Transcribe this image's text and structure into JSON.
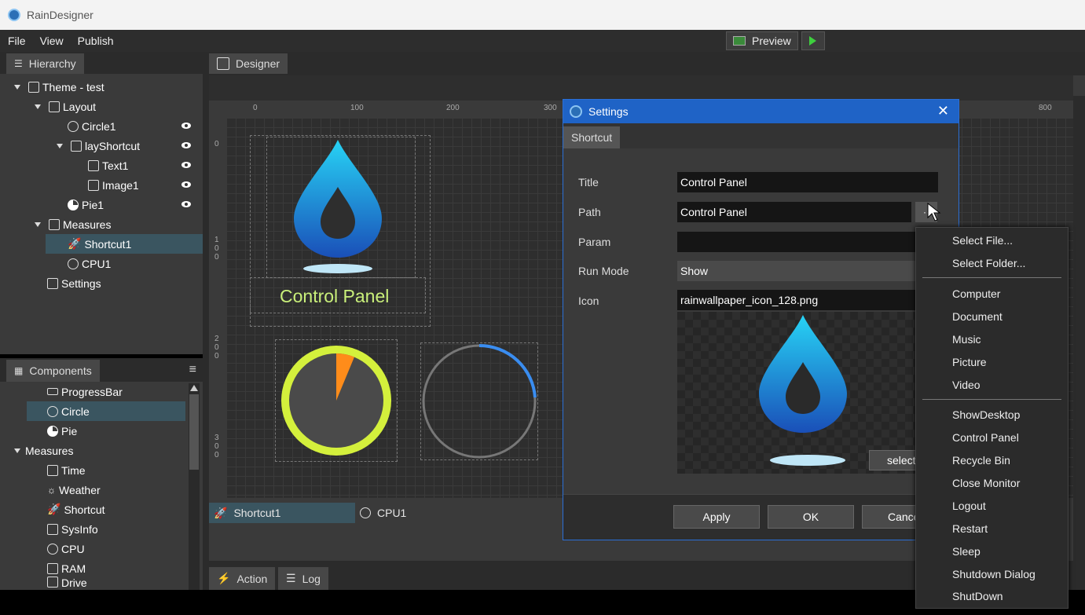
{
  "app": {
    "title": "RainDesigner"
  },
  "menu": [
    "File",
    "View",
    "Publish"
  ],
  "toolbar": {
    "preview_label": "Preview"
  },
  "hierarchy": {
    "tab_label": "Hierarchy",
    "items": [
      {
        "label": "Theme - test"
      },
      {
        "label": "Layout"
      },
      {
        "label": "Circle1"
      },
      {
        "label": "layShortcut"
      },
      {
        "label": "Text1"
      },
      {
        "label": "Image1"
      },
      {
        "label": "Pie1"
      },
      {
        "label": "Measures"
      },
      {
        "label": "Shortcut1"
      },
      {
        "label": "CPU1"
      },
      {
        "label": "Settings"
      }
    ]
  },
  "components": {
    "tab_label": "Components",
    "items": [
      {
        "label": "ProgressBar"
      },
      {
        "label": "Circle"
      },
      {
        "label": "Pie"
      },
      {
        "label": "Measures"
      },
      {
        "label": "Time"
      },
      {
        "label": "Weather"
      },
      {
        "label": "Shortcut"
      },
      {
        "label": "SysInfo"
      },
      {
        "label": "CPU"
      },
      {
        "label": "RAM"
      },
      {
        "label": "Drive"
      }
    ]
  },
  "designer": {
    "tab_label": "Designer",
    "ruler_h": [
      "0",
      "100",
      "200",
      "300",
      "800"
    ],
    "ruler_v": [
      "0",
      "1\n0\n0",
      "2\n0\n0",
      "3\n0\n0"
    ],
    "canvas_text": "Control Panel",
    "bottom_items": [
      "Shortcut1",
      "CPU1"
    ]
  },
  "bottom_tabs": [
    "Action",
    "Log"
  ],
  "dialog": {
    "title": "Settings",
    "tab": "Shortcut",
    "labels": {
      "title": "Title",
      "path": "Path",
      "param": "Param",
      "run_mode": "Run Mode",
      "icon": "Icon"
    },
    "values": {
      "title": "Control Panel",
      "path": "Control Panel",
      "param": "",
      "run_mode": "Show",
      "icon": "rainwallpaper_icon_128.png"
    },
    "browse_label": "··",
    "select_label": "select",
    "buttons": {
      "apply": "Apply",
      "ok": "OK",
      "cancel": "Cance"
    }
  },
  "context_menu": {
    "group1": [
      "Select File...",
      "Select Folder..."
    ],
    "group2": [
      "Computer",
      "Document",
      "Music",
      "Picture",
      "Video"
    ],
    "group3": [
      "ShowDesktop",
      "Control Panel",
      "Recycle Bin",
      "Close Monitor",
      "Logout",
      "Restart",
      "Sleep",
      "Shutdown Dialog",
      "ShutDown"
    ]
  },
  "colors": {
    "accent": "#1f63c6",
    "pie_ring": "#d4f03c",
    "pie_slice": "#ff8c1a",
    "arc": "#3a8df0",
    "label_green": "#c9ef7a"
  }
}
